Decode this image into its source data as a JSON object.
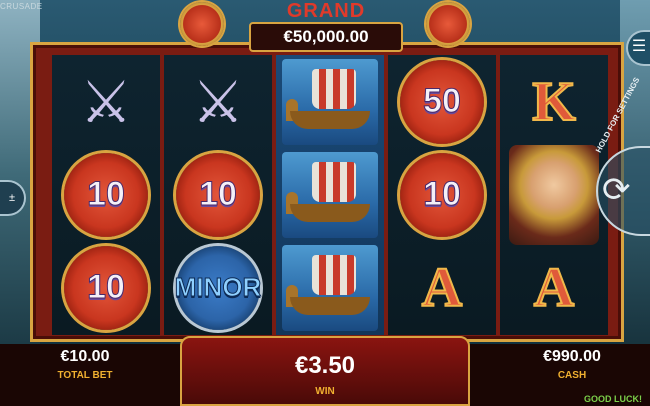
{
  "game": {
    "title_fragment": "CRUSADE"
  },
  "jackpot": {
    "label": "GRAND",
    "amount": "€50,000.00"
  },
  "reels": [
    [
      "axes",
      "10",
      "10"
    ],
    [
      "axes",
      "10",
      "MINOR"
    ],
    [
      "ship",
      "ship",
      "ship"
    ],
    [
      "50",
      "10",
      "A"
    ],
    [
      "K",
      "viking",
      "A"
    ]
  ],
  "controls": {
    "menu_icon": "hamburger-icon",
    "spin_label": "HOLD FOR SETTINGS",
    "spin_icon": "refresh-icon",
    "left_button": "±"
  },
  "bottom_bar": {
    "total_bet_value": "€10.00",
    "total_bet_label": "TOTAL BET",
    "win_value": "€3.50",
    "win_label": "WIN",
    "cash_value": "€990.00",
    "cash_label": "CASH",
    "status": "GOOD LUCK!"
  },
  "colors": {
    "frame": "#7a1c12",
    "gold": "#d9a441",
    "win_label": "#f0b030",
    "status": "#7cd04a"
  }
}
